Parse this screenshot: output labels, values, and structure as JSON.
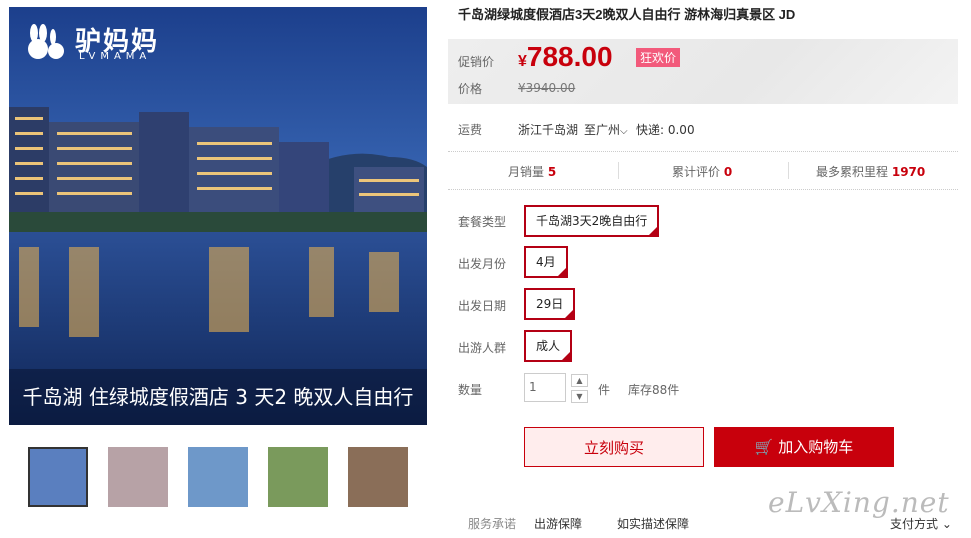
{
  "gallery": {
    "logo_text": "驴妈妈",
    "logo_sub": "LVMAMA",
    "caption": "千岛湖 住绿城度假酒店 3 天2 晚双人自由行",
    "thumbnails": [
      "thumb-1",
      "thumb-2",
      "thumb-3",
      "thumb-4",
      "thumb-5"
    ],
    "thumb_colors": [
      "#5a7fbf",
      "#b7a2a6",
      "#6e98c9",
      "#7a9a5c",
      "#8a6e58"
    ]
  },
  "product": {
    "title": "千岛湖绿城度假酒店3天2晚双人自由行 游林海归真景区 JD"
  },
  "price": {
    "promo_label": "促销价",
    "currency": "¥",
    "promo_value": "788.00",
    "badge": "狂欢价",
    "orig_label": "价格",
    "orig_value": "¥3940.00"
  },
  "shipping": {
    "label": "运费",
    "from": "浙江千岛湖",
    "to": "至广州",
    "fee": "快递: 0.00"
  },
  "stats": {
    "monthly_label": "月销量",
    "monthly_value": "5",
    "reviews_label": "累计评价",
    "reviews_value": "0",
    "points_label": "最多累积里程",
    "points_value": "1970"
  },
  "options": {
    "package_label": "套餐类型",
    "package_value": "千岛湖3天2晚自由行",
    "month_label": "出发月份",
    "month_value": "4月",
    "date_label": "出发日期",
    "date_value": "29日",
    "group_label": "出游人群",
    "group_value": "成人"
  },
  "quantity": {
    "label": "数量",
    "value": "1",
    "unit": "件",
    "stock": "库存88件"
  },
  "actions": {
    "buy_now": "立刻购买",
    "add_cart": "加入购物车"
  },
  "service": {
    "label": "服务承诺",
    "item1": "出游保障",
    "item2": "如实描述保障",
    "payment": "支付方式"
  },
  "watermark": "eLvXing.net",
  "colors": {
    "accent": "#c8000c",
    "badge": "#f25a7b"
  }
}
